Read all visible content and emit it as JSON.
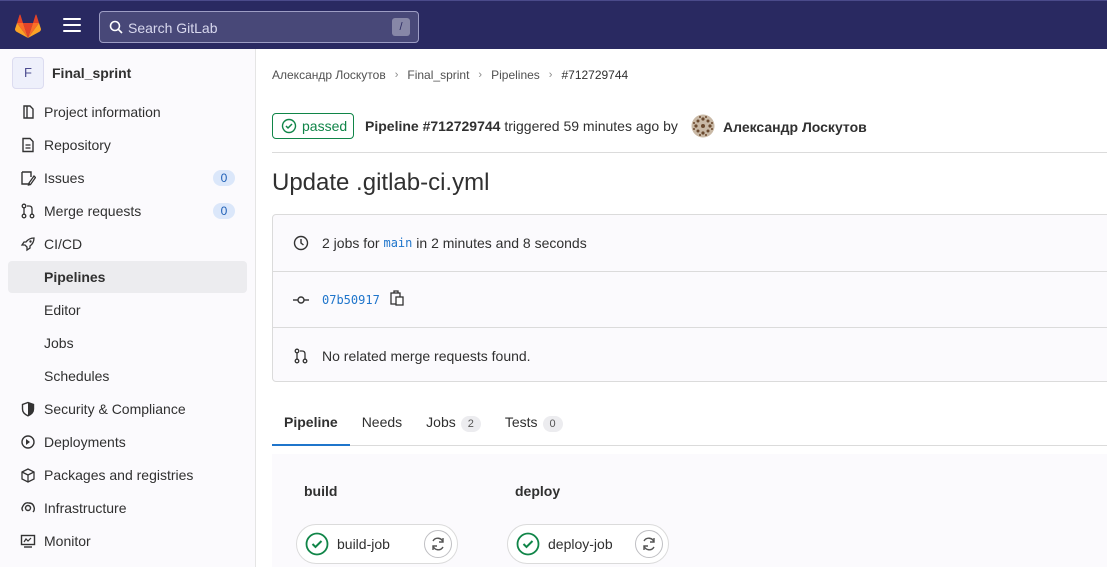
{
  "topbar": {
    "search_placeholder": "Search GitLab",
    "search_shortcut": "/"
  },
  "sidebar": {
    "project_initial": "F",
    "project_name": "Final_sprint",
    "items": [
      {
        "label": "Project information",
        "icon": "info-icon"
      },
      {
        "label": "Repository",
        "icon": "document-icon"
      },
      {
        "label": "Issues",
        "icon": "issues-icon",
        "count": "0"
      },
      {
        "label": "Merge requests",
        "icon": "merge-request-icon",
        "count": "0"
      },
      {
        "label": "CI/CD",
        "icon": "rocket-icon"
      },
      {
        "label": "Pipelines",
        "active": true
      },
      {
        "label": "Editor"
      },
      {
        "label": "Jobs"
      },
      {
        "label": "Schedules"
      },
      {
        "label": "Security & Compliance",
        "icon": "shield-icon"
      },
      {
        "label": "Deployments",
        "icon": "deployments-icon"
      },
      {
        "label": "Packages and registries",
        "icon": "package-icon"
      },
      {
        "label": "Infrastructure",
        "icon": "cloud-gear-icon"
      },
      {
        "label": "Monitor",
        "icon": "monitor-icon"
      }
    ]
  },
  "breadcrumb": {
    "items": [
      "Александр Лоскутов",
      "Final_sprint",
      "Pipelines",
      "#712729744"
    ]
  },
  "pipeline": {
    "status": "passed",
    "title_prefix": "Pipeline #712729744",
    "triggered_text": "triggered 59 minutes ago by",
    "user": "Александр Лоскутов",
    "commit_title": "Update .gitlab-ci.yml",
    "jobs_prefix": "2 jobs for",
    "branch": "main",
    "duration_text": "in 2 minutes and 8 seconds",
    "commit_sha": "07b50917",
    "merge_requests_text": "No related merge requests found."
  },
  "tabs": [
    {
      "label": "Pipeline",
      "active": true
    },
    {
      "label": "Needs"
    },
    {
      "label": "Jobs",
      "count": "2"
    },
    {
      "label": "Tests",
      "count": "0"
    }
  ],
  "stages": [
    {
      "name": "build",
      "job": "build-job"
    },
    {
      "name": "deploy",
      "job": "deploy-job"
    }
  ],
  "colors": {
    "topbar": "#292961",
    "success": "#108548",
    "link": "#1f75cb"
  }
}
